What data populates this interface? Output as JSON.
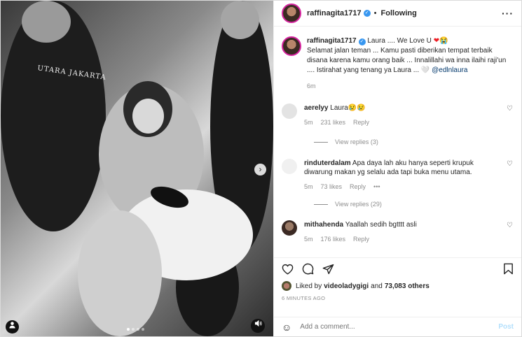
{
  "media": {
    "shirt_text": "UTARA JAKARTA",
    "next_icon": "chevron-right-icon",
    "dots": 4
  },
  "header": {
    "username": "raffinagita1717",
    "follow_label": "Following",
    "more_icon": "more-horizontal-icon"
  },
  "caption": {
    "username": "raffinagita1717",
    "text_line1": "Laura .... We Love U ",
    "emojis": "❤😭",
    "body": "Selamat jalan teman ... Kamu pasti diberikan tempat terbaik disana karena kamu orang baik ... Innalillahi wa inna ilaihi raji'un .... Istirahat yang tenang ya Laura ... 🤍 ",
    "mention": "@edlnlaura",
    "time": "6m"
  },
  "comments": [
    {
      "username": "aerelyy",
      "text": "Laura😢😢",
      "time": "5m",
      "likes": "231 likes",
      "reply_label": "Reply",
      "view_replies": "View replies (3)"
    },
    {
      "username": "rinduterdalam",
      "text": "Apa daya lah aku hanya seperti krupuk diwarung makan yg selalu ada tapi buka menu utama.",
      "time": "5m",
      "likes": "73 likes",
      "reply_label": "Reply",
      "more": "•••",
      "view_replies": "View replies (29)"
    },
    {
      "username": "mithahenda",
      "text": "Yaallah sedih bgtttt asli",
      "time": "5m",
      "likes": "176 likes",
      "reply_label": "Reply"
    }
  ],
  "actions": {
    "liked_prefix": "Liked by ",
    "liked_user": "videoladygigi",
    "liked_and": " and ",
    "liked_count": "73,083 others",
    "posted": "6 MINUTES AGO"
  },
  "add_comment": {
    "placeholder": "Add a comment...",
    "post_label": "Post"
  },
  "colors": {
    "verified": "#3897f0",
    "heart": "#ed1c24",
    "post_disabled": "#b2dffc"
  }
}
